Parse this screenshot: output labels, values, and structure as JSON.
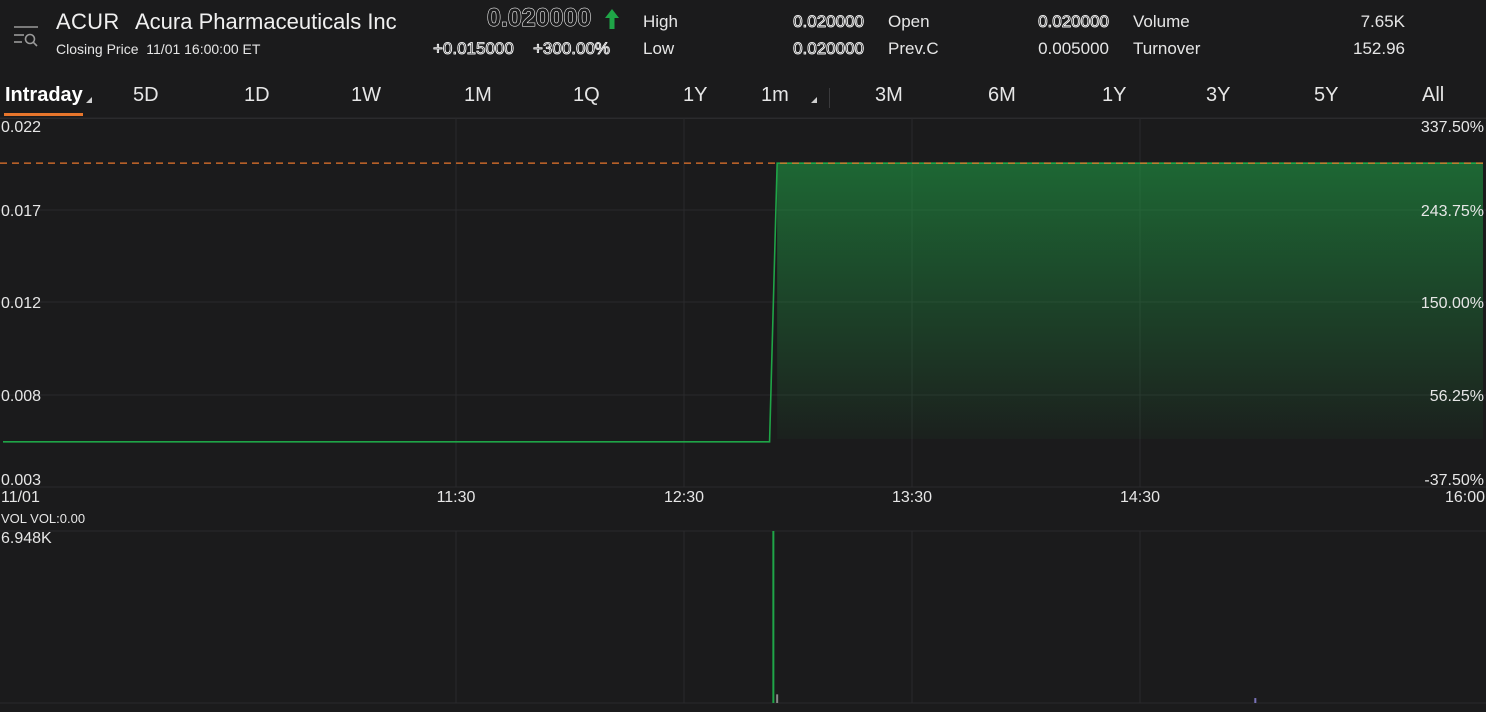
{
  "header": {
    "symbol": "ACUR",
    "company": "Acura Pharmaceuticals Inc",
    "closing_label": "Closing Price",
    "closing_time": "11/01 16:00:00 ET",
    "price": "0.020000",
    "change": "+0.015000",
    "change_pct": "+300.00%",
    "up_color": "#1fa547",
    "stats": {
      "high_label": "High",
      "high_value": "0.020000",
      "low_label": "Low",
      "low_value": "0.020000",
      "open_label": "Open",
      "open_value": "0.020000",
      "prevc_label": "Prev.C",
      "prevc_value": "0.005000",
      "volume_label": "Volume",
      "volume_value": "7.65K",
      "turnover_label": "Turnover",
      "turnover_value": "152.96"
    }
  },
  "tabs": [
    {
      "label": "Intraday",
      "active": true,
      "dropdown": true
    },
    {
      "label": "5D"
    },
    {
      "label": "1D"
    },
    {
      "label": "1W"
    },
    {
      "label": "1M"
    },
    {
      "label": "1Q"
    },
    {
      "label": "1Y"
    },
    {
      "label": "1m",
      "dropdown": true
    },
    {
      "label": "3M"
    },
    {
      "label": "6M"
    },
    {
      "label": "1Y"
    },
    {
      "label": "3Y"
    },
    {
      "label": "5Y"
    },
    {
      "label": "All"
    }
  ],
  "volume_panel": {
    "label": "VOL  VOL:0.00",
    "max_label": "6.948K"
  },
  "chart_data": {
    "type": "area",
    "x_tick_labels": [
      "11/01",
      "11:30",
      "12:30",
      "13:30",
      "14:30",
      "16:00"
    ],
    "y_tick_labels_left": [
      "0.022",
      "0.017",
      "0.012",
      "0.008",
      "0.003"
    ],
    "y_tick_labels_right": [
      "337.50%",
      "243.75%",
      "150.00%",
      "56.25%",
      "-37.50%"
    ],
    "ylim": [
      0.003,
      0.022
    ],
    "x_range_minutes": [
      0,
      390
    ],
    "reference_line": {
      "value": 0.02,
      "style": "dashed",
      "color": "#e8762c"
    },
    "series": [
      {
        "x_minutes": [
          0,
          202,
          204,
          390
        ],
        "values": [
          0.005,
          0.005,
          0.02,
          0.02
        ],
        "color": "#1fa547"
      }
    ],
    "volume": {
      "max": 6948,
      "bars": [
        {
          "x_minute": 203,
          "value": 6948,
          "color": "#1fa547"
        },
        {
          "x_minute": 204,
          "value": 350,
          "color": "#8a8a8a"
        },
        {
          "x_minute": 330,
          "value": 200,
          "color": "#7a72b8"
        }
      ]
    },
    "grid": true
  }
}
